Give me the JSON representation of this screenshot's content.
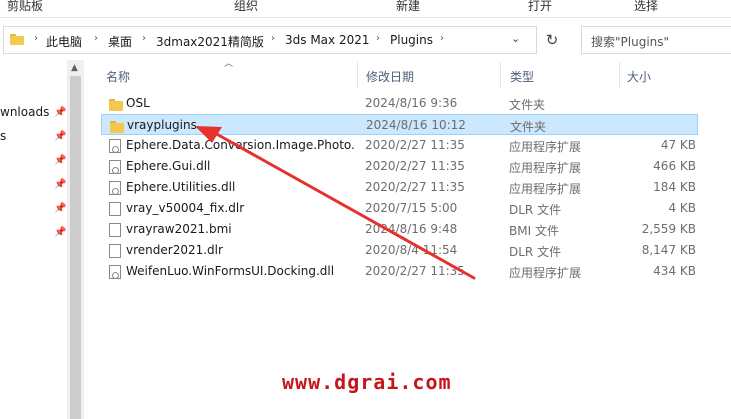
{
  "ribbon": {
    "groups": [
      "剪贴板",
      "组织",
      "新建",
      "打开",
      "选择"
    ]
  },
  "address_bar": {
    "crumbs": [
      "此电脑",
      "桌面",
      "3dmax2021精简版",
      "3ds Max 2021",
      "Plugins"
    ],
    "separator": "›",
    "dropdown_glyph": "⌄",
    "refresh_glyph": "↻"
  },
  "search": {
    "placeholder": "搜索\"Plugins\""
  },
  "nav_pane": {
    "items": [
      {
        "label": "wnloads",
        "pinned": true
      },
      {
        "label": "s",
        "pinned": true
      },
      {
        "label": "",
        "pinned": true
      },
      {
        "label": "",
        "pinned": true
      },
      {
        "label": "",
        "pinned": true
      },
      {
        "label": "",
        "pinned": true
      }
    ],
    "pin_glyph": "📌"
  },
  "columns": {
    "name": "名称",
    "date": "修改日期",
    "type": "类型",
    "size": "大小"
  },
  "files": [
    {
      "name": "OSL",
      "date": "2024/8/16 9:36",
      "type": "文件夹",
      "size": "",
      "kind": "folder",
      "selected": false
    },
    {
      "name": "vrayplugins",
      "date": "2024/8/16 10:12",
      "type": "文件夹",
      "size": "",
      "kind": "folder",
      "selected": true
    },
    {
      "name": "Ephere.Data.Conversion.Image.Photo...",
      "date": "2020/2/27 11:35",
      "type": "应用程序扩展",
      "size": "47 KB",
      "kind": "dll",
      "selected": false
    },
    {
      "name": "Ephere.Gui.dll",
      "date": "2020/2/27 11:35",
      "type": "应用程序扩展",
      "size": "466 KB",
      "kind": "dll",
      "selected": false
    },
    {
      "name": "Ephere.Utilities.dll",
      "date": "2020/2/27 11:35",
      "type": "应用程序扩展",
      "size": "184 KB",
      "kind": "dll",
      "selected": false
    },
    {
      "name": "vray_v50004_fix.dlr",
      "date": "2020/7/15 5:00",
      "type": "DLR 文件",
      "size": "4 KB",
      "kind": "file",
      "selected": false
    },
    {
      "name": "vrayraw2021.bmi",
      "date": "2024/8/16 9:48",
      "type": "BMI 文件",
      "size": "2,559 KB",
      "kind": "file",
      "selected": false
    },
    {
      "name": "vrender2021.dlr",
      "date": "2020/8/4 11:54",
      "type": "DLR 文件",
      "size": "8,147 KB",
      "kind": "file",
      "selected": false
    },
    {
      "name": "WeifenLuo.WinFormsUI.Docking.dll",
      "date": "2020/2/27 11:35",
      "type": "应用程序扩展",
      "size": "434 KB",
      "kind": "dll",
      "selected": false
    }
  ],
  "watermark": "www.dgrai.com",
  "colors": {
    "selection_bg": "#cce8ff",
    "selection_border": "#99d1ff",
    "arrow": "#e5322d",
    "watermark": "#c4161c"
  }
}
